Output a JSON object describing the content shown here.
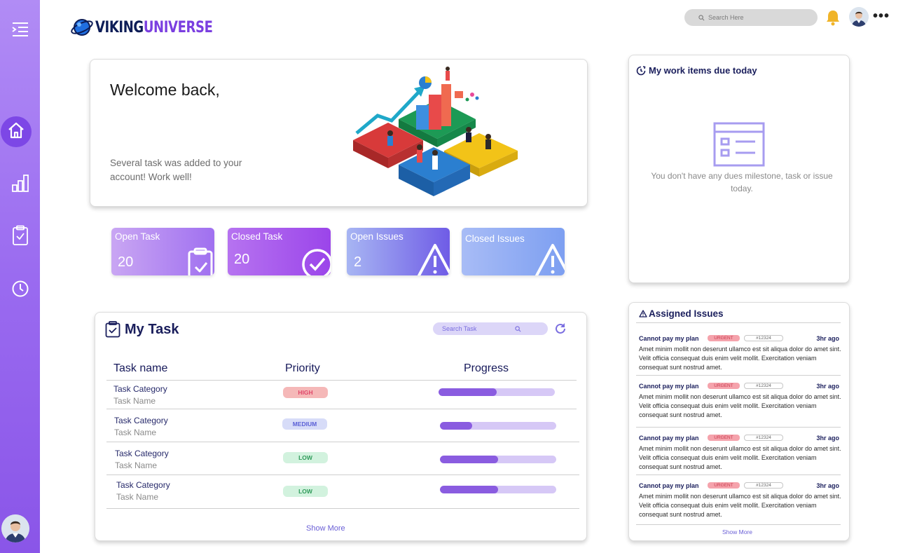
{
  "app": {
    "logo_primary": "VIKING",
    "logo_secondary": "UNIVERSE",
    "brand_color": "#7b3fe0"
  },
  "sidebar": {
    "items": [
      {
        "icon": "menu-icon"
      },
      {
        "icon": "home-icon"
      },
      {
        "icon": "chart-icon"
      },
      {
        "icon": "clipboard-icon"
      },
      {
        "icon": "clock-icon"
      }
    ],
    "avatar": "user-avatar"
  },
  "header": {
    "search_placeholder": "Search Here",
    "icons": [
      "bell-icon",
      "avatar",
      "more-icon"
    ]
  },
  "welcome": {
    "title": "Welcome back,",
    "subtitle": "Several task was added to your account! Work well!"
  },
  "stats": [
    {
      "label": "Open Task",
      "value": "20"
    },
    {
      "label": "Closed Task",
      "value": "20"
    },
    {
      "label": "Open Issues",
      "value": "2"
    },
    {
      "label": "Closed Issues",
      "value": ""
    }
  ],
  "due_today": {
    "title": "My work items due today",
    "empty_message": "You don't have any dues milestone, task or issue today."
  },
  "tasks": {
    "title": "My Task",
    "search_placeholder": "Search Task",
    "columns": [
      "Task name",
      "Priority",
      "Progress"
    ],
    "rows": [
      {
        "category": "Task Category",
        "name": "Task Name",
        "priority": "HIGH",
        "progress": 0.5
      },
      {
        "category": "Task Category",
        "name": "Task Name",
        "priority": "MEDIUM",
        "progress": 0.28
      },
      {
        "category": "Task Category",
        "name": "Task Name",
        "priority": "LOW",
        "progress": 0.5
      },
      {
        "category": "Task Category",
        "name": "Task Name",
        "priority": "LOW",
        "progress": 0.5
      }
    ],
    "show_more": "Show More"
  },
  "issues": {
    "title": "Assigned Issues",
    "items": [
      {
        "title": "Cannot pay my plan",
        "tag": "URGENT",
        "id": "#12324",
        "time": "3hr ago",
        "body": "Amet minim mollit non deserunt ullamco est sit aliqua dolor do amet sint. Velit officia consequat duis enim velit mollit. Exercitation veniam consequat sunt nostrud amet."
      },
      {
        "title": "Cannot pay my plan",
        "tag": "URGENT",
        "id": "#12324",
        "time": "3hr ago",
        "body": "Amet minim mollit non deserunt ullamco est sit aliqua dolor do amet sint. Velit officia consequat duis enim velit mollit. Exercitation veniam consequat sunt nostrud amet."
      },
      {
        "title": "Cannot pay my plan",
        "tag": "URGENT",
        "id": "#12324",
        "time": "3hr ago",
        "body": "Amet minim mollit non deserunt ullamco est sit aliqua dolor do amet sint. Velit officia consequat duis enim velit mollit. Exercitation veniam consequat sunt nostrud amet."
      },
      {
        "title": "Cannot pay my plan",
        "tag": "URGENT",
        "id": "#12324",
        "time": "3hr ago",
        "body": "Amet minim mollit non deserunt ullamco est sit aliqua dolor do amet sint. Velit officia consequat duis enim velit mollit. Exercitation veniam consequat sunt nostrud amet."
      }
    ],
    "show_more": "Show More"
  }
}
